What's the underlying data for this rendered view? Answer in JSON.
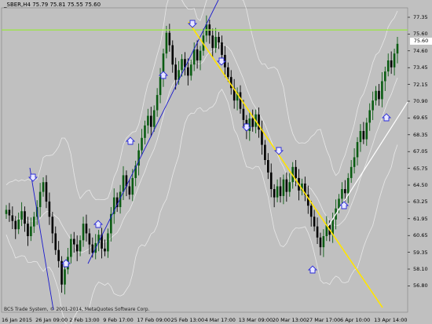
{
  "header": {
    "symbol_line": "_SBER,H4  75.79 75.81 75.55 75.60"
  },
  "footer": {
    "copyright": "BCS Trade System, © 2001-2014, MetaQuotes Software Corp."
  },
  "current_price_label": "75.60",
  "colors": {
    "background": "#c0c0c0",
    "bull_candle": "#0a5c12",
    "bear_candle": "#000000",
    "bollinger": "#e8e8e8",
    "horizontal_level": "#9be34a",
    "trendline_yellow": "#ffe500",
    "trendline_blue": "#1a1acc",
    "trendline_white": "#ffffff",
    "arrow": "#2a2ad8"
  },
  "chart_data": {
    "type": "candlestick",
    "symbol": "_SBER",
    "timeframe": "H4",
    "ohlc_current": {
      "open": 75.79,
      "high": 75.81,
      "low": 75.55,
      "close": 75.6
    },
    "ylim": [
      56.2,
      78.2
    ],
    "y_ticks": [
      77.35,
      76.1,
      74.85,
      73.6,
      72.35,
      71.1,
      69.85,
      68.6,
      67.35,
      66.1,
      64.85,
      63.6,
      62.35,
      61.1,
      59.85,
      58.6,
      57.35
    ],
    "y_tick_labels": [
      "77.35",
      "75.60",
      "74.60",
      "73.45",
      "72.15",
      "70.90",
      "69.65",
      "68.35",
      "67.05",
      "65.75",
      "64.50",
      "63.25",
      "61.95",
      "60.65",
      "59.35",
      "58.10",
      "56.80"
    ],
    "x_tick_labels": [
      "16 Jan 2015",
      "26 Jan 09:00",
      "2 Feb 13:00",
      "9 Feb 17:00",
      "17 Feb 09:00",
      "25 Feb 13:00",
      "4 Mar 17:00",
      "13 Mar 09:00",
      "20 Mar 13:00",
      "27 Mar 17:00",
      "6 Apr 10:00",
      "13 Apr 14:00"
    ],
    "horizontal_level": 76.6,
    "closes": [
      63.6,
      63.2,
      62.8,
      62.2,
      62.9,
      63.5,
      62.6,
      61.7,
      62.4,
      63.1,
      63.8,
      64.9,
      65.6,
      64.2,
      63.1,
      61.9,
      60.7,
      59.9,
      58.2,
      59.3,
      60.2,
      61.5,
      61.1,
      60.6,
      61.4,
      62.6,
      61.9,
      61.1,
      60.5,
      61.2,
      61.8,
      60.8,
      60.6,
      61.9,
      63.3,
      64.5,
      63.8,
      64.9,
      66.1,
      65.3,
      64.7,
      65.9,
      66.8,
      67.9,
      68.8,
      69.7,
      70.4,
      69.6,
      70.8,
      71.9,
      73.2,
      74.9,
      76.4,
      75.5,
      74.1,
      73.0,
      73.7,
      74.5,
      73.9,
      73.3,
      74.1,
      75.2,
      74.4,
      75.1,
      76.2,
      77.0,
      76.2,
      75.3,
      76.1,
      75.7,
      74.8,
      73.9,
      73.2,
      72.4,
      71.5,
      72.1,
      70.9,
      70.1,
      69.3,
      70.2,
      69.6,
      70.5,
      69.4,
      68.3,
      67.2,
      66.3,
      65.1,
      64.5,
      65.3,
      64.6,
      65.8,
      64.9,
      65.6,
      66.7,
      65.9,
      65.0,
      65.5,
      64.7,
      63.9,
      63.1,
      62.4,
      61.6,
      60.9,
      61.7,
      62.5,
      61.8,
      62.9,
      63.7,
      64.4,
      65.1,
      64.8,
      65.9,
      66.7,
      67.4,
      68.5,
      69.3,
      68.7,
      69.9,
      70.8,
      71.5,
      72.2,
      71.6,
      72.9,
      73.6,
      74.4,
      73.9,
      74.9,
      75.6
    ]
  }
}
